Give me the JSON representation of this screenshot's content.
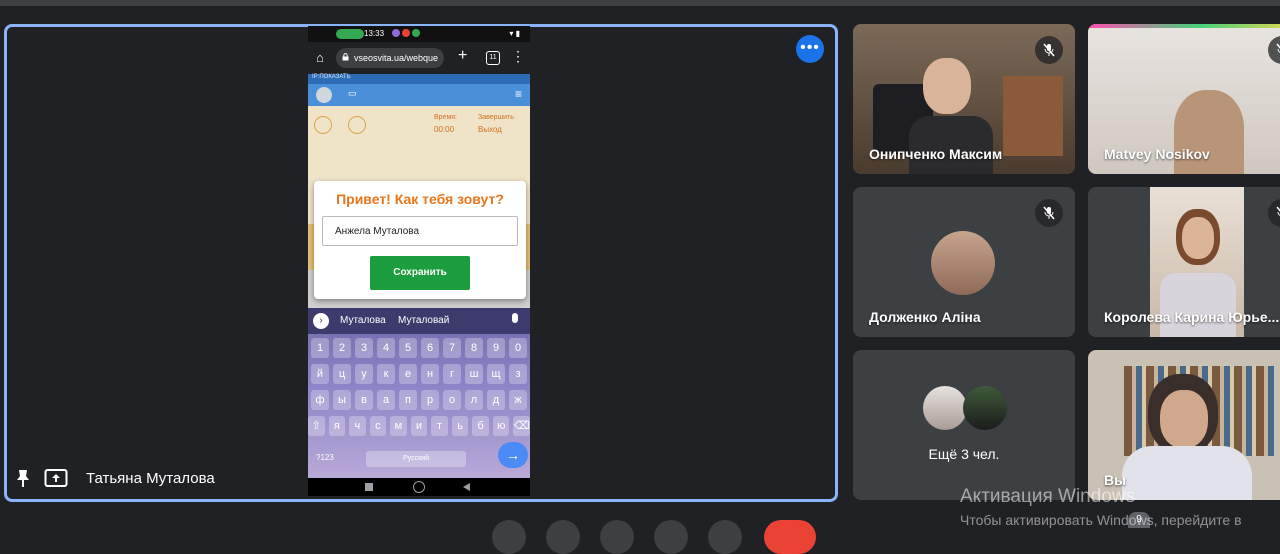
{
  "presenter": {
    "name": "Татьяна Муталова",
    "phone": {
      "status_time": "13:33",
      "url": "vseosvita.ua/webque",
      "tab_count": "11",
      "page_strip": "IP:ПОКАЗАТЬ",
      "page_labels": [
        "Время:",
        "Завершить",
        "00:00",
        "Выход"
      ],
      "modal": {
        "title": "Привет! Как тебя зовут?",
        "input_value": "Анжела Муталова",
        "save_label": "Сохранить"
      },
      "keyboard": {
        "suggestions": [
          "Муталова",
          "Муталовай"
        ],
        "rows": [
          [
            "1",
            "2",
            "3",
            "4",
            "5",
            "6",
            "7",
            "8",
            "9",
            "0"
          ],
          [
            "й",
            "ц",
            "у",
            "к",
            "е",
            "н",
            "г",
            "ш",
            "щ",
            "з"
          ],
          [
            "ф",
            "ы",
            "в",
            "а",
            "п",
            "р",
            "о",
            "л",
            "д",
            "ж"
          ],
          [
            "я",
            "ч",
            "с",
            "м",
            "и",
            "т",
            "ь",
            "б",
            "ю"
          ]
        ],
        "mode_label": "?123",
        "space_label": "Русский"
      }
    }
  },
  "participants": [
    {
      "name": "Онипченко Максим",
      "muted": true
    },
    {
      "name": "Matvey Nosikov",
      "muted": true
    },
    {
      "name": "Долженко Аліна",
      "muted": true
    },
    {
      "name": "Королева Карина Юрье...",
      "muted": true
    },
    {
      "name": "Ещё 3 чел.",
      "muted": false
    },
    {
      "name": "Вы",
      "muted": false
    }
  ],
  "others_badge": "9",
  "watermark": {
    "title": "Активация Windows",
    "subtitle": "Чтобы активировать Windows, перейдите в"
  },
  "colors": {
    "background": "#202124",
    "tile": "#3c4043",
    "accent": "#8ab4f8",
    "button_blue": "#1a73e8",
    "save_green": "#1d9e3e",
    "modal_title": "#e8761c"
  }
}
